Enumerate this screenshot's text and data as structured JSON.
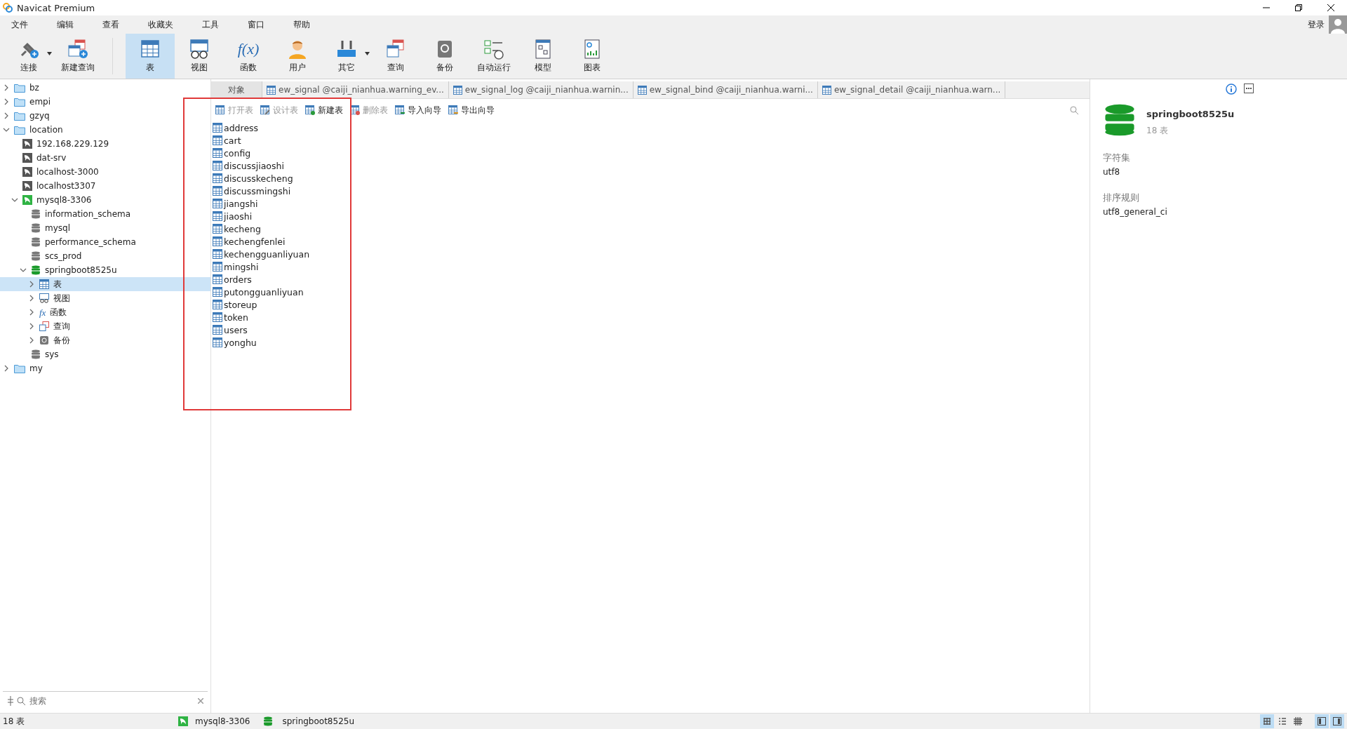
{
  "window": {
    "title": "Navicat Premium"
  },
  "menu": [
    "文件",
    "编辑",
    "查看",
    "收藏夹",
    "工具",
    "窗口",
    "帮助"
  ],
  "account": {
    "login": "登录"
  },
  "toolbar": [
    {
      "label": "连接",
      "kind": "connect",
      "selected": false,
      "dropdown": true
    },
    {
      "label": "新建查询",
      "kind": "newquery",
      "selected": false,
      "dropdown": false
    },
    {
      "label": "表",
      "kind": "table",
      "selected": true,
      "dropdown": false
    },
    {
      "label": "视图",
      "kind": "view",
      "selected": false,
      "dropdown": false
    },
    {
      "label": "函数",
      "kind": "function",
      "glyph": "f(x)",
      "selected": false,
      "dropdown": false
    },
    {
      "label": "用户",
      "kind": "user",
      "selected": false,
      "dropdown": false
    },
    {
      "label": "其它",
      "kind": "tools",
      "selected": false,
      "dropdown": true
    },
    {
      "label": "查询",
      "kind": "query",
      "selected": false,
      "dropdown": false
    },
    {
      "label": "备份",
      "kind": "backup",
      "selected": false,
      "dropdown": false
    },
    {
      "label": "自动运行",
      "kind": "schedule",
      "selected": false,
      "dropdown": false
    },
    {
      "label": "模型",
      "kind": "model",
      "selected": false,
      "dropdown": false
    },
    {
      "label": "图表",
      "kind": "chart",
      "selected": false,
      "dropdown": false
    }
  ],
  "sidebar": {
    "tree": [
      {
        "label": "bz",
        "kind": "folder",
        "expanded": false,
        "selected": false
      },
      {
        "label": "empi",
        "kind": "folder",
        "expanded": false,
        "selected": false
      },
      {
        "label": "gzyq",
        "kind": "folder",
        "expanded": false,
        "selected": false
      },
      {
        "label": "location",
        "kind": "folder",
        "expanded": true,
        "selected": false,
        "children": [
          {
            "label": "192.168.229.129",
            "kind": "connection",
            "connected": false,
            "selected": false
          },
          {
            "label": "dat-srv",
            "kind": "connection",
            "connected": false,
            "selected": false
          },
          {
            "label": "localhost-3000",
            "kind": "connection",
            "connected": false,
            "selected": false
          },
          {
            "label": "localhost3307",
            "kind": "connection",
            "connected": false,
            "selected": false
          },
          {
            "label": "mysql8-3306",
            "kind": "connection",
            "connected": true,
            "expanded": true,
            "selected": false,
            "children": [
              {
                "label": "information_schema",
                "kind": "database",
                "open": false,
                "selected": false
              },
              {
                "label": "mysql",
                "kind": "database",
                "open": false,
                "selected": false
              },
              {
                "label": "performance_schema",
                "kind": "database",
                "open": false,
                "selected": false
              },
              {
                "label": "scs_prod",
                "kind": "database",
                "open": false,
                "selected": false
              },
              {
                "label": "springboot8525u",
                "kind": "database",
                "open": true,
                "expanded": true,
                "selected": false,
                "children": [
                  {
                    "label": "表",
                    "kind": "tables",
                    "expanded": false,
                    "selected": true
                  },
                  {
                    "label": "视图",
                    "kind": "views",
                    "expanded": false,
                    "selected": false
                  },
                  {
                    "label": "函数",
                    "kind": "functions",
                    "glyph": "fx",
                    "expanded": false,
                    "selected": false
                  },
                  {
                    "label": "查询",
                    "kind": "queries",
                    "expanded": false,
                    "selected": false
                  },
                  {
                    "label": "备份",
                    "kind": "backups",
                    "expanded": false,
                    "selected": false
                  }
                ]
              },
              {
                "label": "sys",
                "kind": "database",
                "open": false,
                "selected": false
              }
            ]
          }
        ]
      },
      {
        "label": "my",
        "kind": "folder",
        "expanded": false,
        "selected": false
      }
    ],
    "search": {
      "placeholder": "搜索"
    }
  },
  "tabs": [
    {
      "label": "对象",
      "kind": "objects",
      "selected": true
    },
    {
      "label": "ew_signal @caiji_nianhua.warning_ev...",
      "kind": "table",
      "selected": false
    },
    {
      "label": "ew_signal_log @caiji_nianhua.warnin...",
      "kind": "table",
      "selected": false
    },
    {
      "label": "ew_signal_bind @caiji_nianhua.warni...",
      "kind": "table",
      "selected": false
    },
    {
      "label": "ew_signal_detail @caiji_nianhua.warn...",
      "kind": "table",
      "selected": false
    }
  ],
  "object_toolbar": [
    {
      "label": "打开表",
      "kind": "open",
      "disabled": true
    },
    {
      "label": "设计表",
      "kind": "design",
      "disabled": true
    },
    {
      "label": "新建表",
      "kind": "new",
      "disabled": false
    },
    {
      "label": "删除表",
      "kind": "delete",
      "disabled": true
    },
    {
      "label": "导入向导",
      "kind": "import",
      "disabled": false
    },
    {
      "label": "导出向导",
      "kind": "export",
      "disabled": false
    }
  ],
  "objects": [
    "address",
    "cart",
    "config",
    "discussjiaoshi",
    "discusskecheng",
    "discussmingshi",
    "jiangshi",
    "jiaoshi",
    "kecheng",
    "kechengfenlei",
    "kechengguanliyuan",
    "mingshi",
    "orders",
    "putongguanliyuan",
    "storeup",
    "token",
    "users",
    "yonghu"
  ],
  "info_panel": {
    "name": "springboot8525u",
    "count": "18 表",
    "fields": [
      {
        "label": "字符集",
        "value": "utf8"
      },
      {
        "label": "排序规则",
        "value": "utf8_general_ci"
      }
    ]
  },
  "status_bar": {
    "count": "18 表",
    "connection": "mysql8-3306",
    "database": "springboot8525u",
    "view_modes": [
      {
        "kind": "grid",
        "selected": true
      },
      {
        "kind": "list",
        "selected": false
      },
      {
        "kind": "detail",
        "selected": false
      }
    ],
    "panels": [
      {
        "kind": "left",
        "selected": true
      },
      {
        "kind": "right",
        "selected": true
      }
    ]
  }
}
